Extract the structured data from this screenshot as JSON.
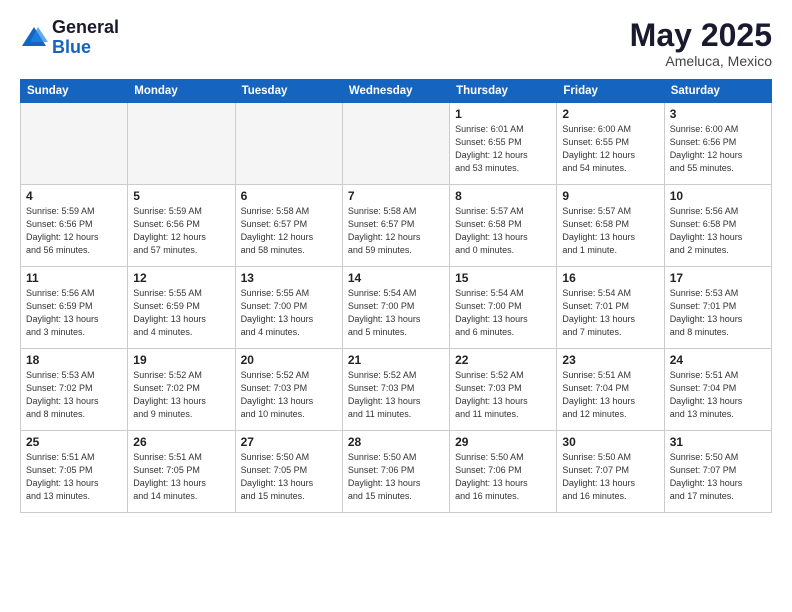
{
  "header": {
    "logo_line1": "General",
    "logo_line2": "Blue",
    "main_title": "May 2025",
    "subtitle": "Ameluca, Mexico"
  },
  "days_of_week": [
    "Sunday",
    "Monday",
    "Tuesday",
    "Wednesday",
    "Thursday",
    "Friday",
    "Saturday"
  ],
  "weeks": [
    [
      {
        "day": "",
        "info": ""
      },
      {
        "day": "",
        "info": ""
      },
      {
        "day": "",
        "info": ""
      },
      {
        "day": "",
        "info": ""
      },
      {
        "day": "1",
        "info": "Sunrise: 6:01 AM\nSunset: 6:55 PM\nDaylight: 12 hours\nand 53 minutes."
      },
      {
        "day": "2",
        "info": "Sunrise: 6:00 AM\nSunset: 6:55 PM\nDaylight: 12 hours\nand 54 minutes."
      },
      {
        "day": "3",
        "info": "Sunrise: 6:00 AM\nSunset: 6:56 PM\nDaylight: 12 hours\nand 55 minutes."
      }
    ],
    [
      {
        "day": "4",
        "info": "Sunrise: 5:59 AM\nSunset: 6:56 PM\nDaylight: 12 hours\nand 56 minutes."
      },
      {
        "day": "5",
        "info": "Sunrise: 5:59 AM\nSunset: 6:56 PM\nDaylight: 12 hours\nand 57 minutes."
      },
      {
        "day": "6",
        "info": "Sunrise: 5:58 AM\nSunset: 6:57 PM\nDaylight: 12 hours\nand 58 minutes."
      },
      {
        "day": "7",
        "info": "Sunrise: 5:58 AM\nSunset: 6:57 PM\nDaylight: 12 hours\nand 59 minutes."
      },
      {
        "day": "8",
        "info": "Sunrise: 5:57 AM\nSunset: 6:58 PM\nDaylight: 13 hours\nand 0 minutes."
      },
      {
        "day": "9",
        "info": "Sunrise: 5:57 AM\nSunset: 6:58 PM\nDaylight: 13 hours\nand 1 minute."
      },
      {
        "day": "10",
        "info": "Sunrise: 5:56 AM\nSunset: 6:58 PM\nDaylight: 13 hours\nand 2 minutes."
      }
    ],
    [
      {
        "day": "11",
        "info": "Sunrise: 5:56 AM\nSunset: 6:59 PM\nDaylight: 13 hours\nand 3 minutes."
      },
      {
        "day": "12",
        "info": "Sunrise: 5:55 AM\nSunset: 6:59 PM\nDaylight: 13 hours\nand 4 minutes."
      },
      {
        "day": "13",
        "info": "Sunrise: 5:55 AM\nSunset: 7:00 PM\nDaylight: 13 hours\nand 4 minutes."
      },
      {
        "day": "14",
        "info": "Sunrise: 5:54 AM\nSunset: 7:00 PM\nDaylight: 13 hours\nand 5 minutes."
      },
      {
        "day": "15",
        "info": "Sunrise: 5:54 AM\nSunset: 7:00 PM\nDaylight: 13 hours\nand 6 minutes."
      },
      {
        "day": "16",
        "info": "Sunrise: 5:54 AM\nSunset: 7:01 PM\nDaylight: 13 hours\nand 7 minutes."
      },
      {
        "day": "17",
        "info": "Sunrise: 5:53 AM\nSunset: 7:01 PM\nDaylight: 13 hours\nand 8 minutes."
      }
    ],
    [
      {
        "day": "18",
        "info": "Sunrise: 5:53 AM\nSunset: 7:02 PM\nDaylight: 13 hours\nand 8 minutes."
      },
      {
        "day": "19",
        "info": "Sunrise: 5:52 AM\nSunset: 7:02 PM\nDaylight: 13 hours\nand 9 minutes."
      },
      {
        "day": "20",
        "info": "Sunrise: 5:52 AM\nSunset: 7:03 PM\nDaylight: 13 hours\nand 10 minutes."
      },
      {
        "day": "21",
        "info": "Sunrise: 5:52 AM\nSunset: 7:03 PM\nDaylight: 13 hours\nand 11 minutes."
      },
      {
        "day": "22",
        "info": "Sunrise: 5:52 AM\nSunset: 7:03 PM\nDaylight: 13 hours\nand 11 minutes."
      },
      {
        "day": "23",
        "info": "Sunrise: 5:51 AM\nSunset: 7:04 PM\nDaylight: 13 hours\nand 12 minutes."
      },
      {
        "day": "24",
        "info": "Sunrise: 5:51 AM\nSunset: 7:04 PM\nDaylight: 13 hours\nand 13 minutes."
      }
    ],
    [
      {
        "day": "25",
        "info": "Sunrise: 5:51 AM\nSunset: 7:05 PM\nDaylight: 13 hours\nand 13 minutes."
      },
      {
        "day": "26",
        "info": "Sunrise: 5:51 AM\nSunset: 7:05 PM\nDaylight: 13 hours\nand 14 minutes."
      },
      {
        "day": "27",
        "info": "Sunrise: 5:50 AM\nSunset: 7:05 PM\nDaylight: 13 hours\nand 15 minutes."
      },
      {
        "day": "28",
        "info": "Sunrise: 5:50 AM\nSunset: 7:06 PM\nDaylight: 13 hours\nand 15 minutes."
      },
      {
        "day": "29",
        "info": "Sunrise: 5:50 AM\nSunset: 7:06 PM\nDaylight: 13 hours\nand 16 minutes."
      },
      {
        "day": "30",
        "info": "Sunrise: 5:50 AM\nSunset: 7:07 PM\nDaylight: 13 hours\nand 16 minutes."
      },
      {
        "day": "31",
        "info": "Sunrise: 5:50 AM\nSunset: 7:07 PM\nDaylight: 13 hours\nand 17 minutes."
      }
    ]
  ]
}
